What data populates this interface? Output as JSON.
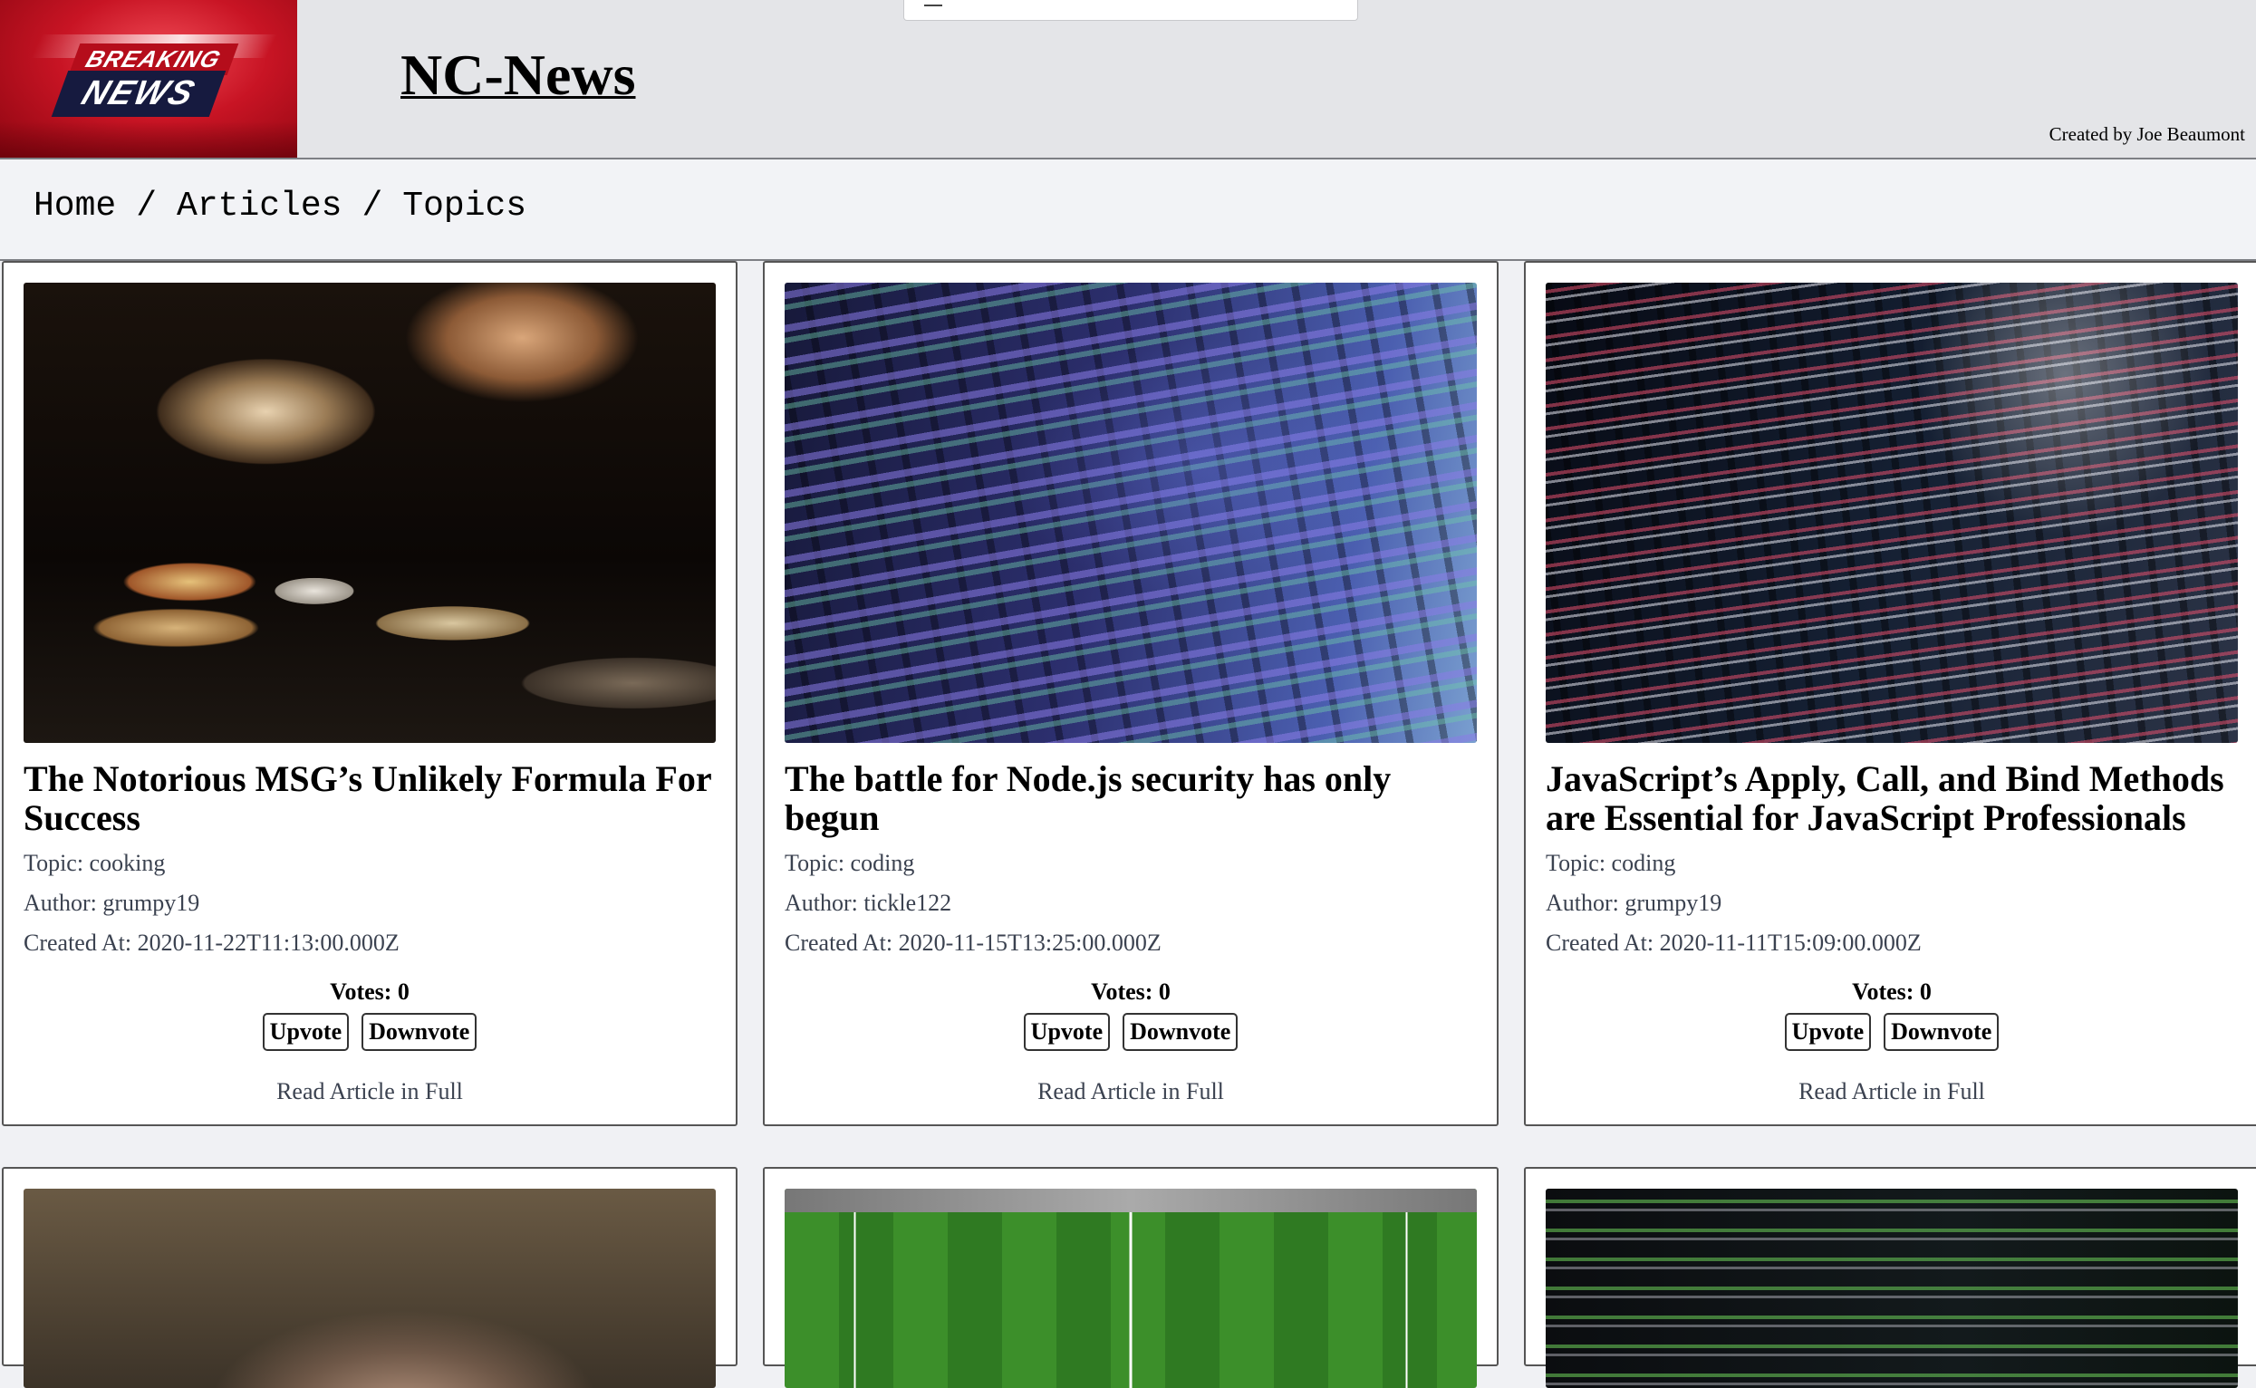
{
  "header": {
    "logo": {
      "line1": "BREAKING",
      "line2": "NEWS"
    },
    "site_title": "NC-News",
    "credit": "Created by Joe Beaumont"
  },
  "nav": {
    "breadcrumbs": [
      "Home",
      "Articles",
      "Topics"
    ],
    "separator": "/"
  },
  "articles": [
    {
      "title": "The Notorious MSG’s Unlikely Formula For Success",
      "topic": "Topic: cooking",
      "author": "Author: grumpy19",
      "created_at": "Created At: 2020-11-22T11:13:00.000Z",
      "votes": "Votes: 0",
      "upvote_label": "Upvote",
      "downvote_label": "Downvote",
      "read_label": "Read Article in Full"
    },
    {
      "title": "The battle for Node.js security has only begun",
      "topic": "Topic: coding",
      "author": "Author: tickle122",
      "created_at": "Created At: 2020-11-15T13:25:00.000Z",
      "votes": "Votes: 0",
      "upvote_label": "Upvote",
      "downvote_label": "Downvote",
      "read_label": "Read Article in Full"
    },
    {
      "title": "JavaScript’s Apply, Call, and Bind Methods are Essential for JavaScript Professionals",
      "topic": "Topic: coding",
      "author": "Author: grumpy19",
      "created_at": "Created At: 2020-11-11T15:09:00.000Z",
      "votes": "Votes: 0",
      "upvote_label": "Upvote",
      "downvote_label": "Downvote",
      "read_label": "Read Article in Full"
    }
  ],
  "colors": {
    "header_bg": "#e4e5e8",
    "logo_red": "#c81424",
    "card_border": "#555555",
    "meta_text": "#3b4250"
  }
}
